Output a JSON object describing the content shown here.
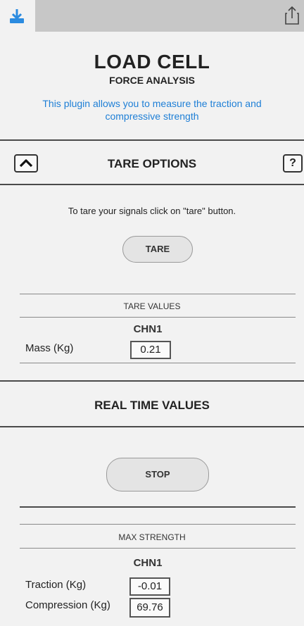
{
  "header": {
    "title": "LOAD CELL",
    "subtitle": "FORCE ANALYSIS",
    "description": "This plugin allows you to measure the traction and compressive strength"
  },
  "tare_section": {
    "title": "TARE OPTIONS",
    "help_label": "?",
    "instruction": "To tare your signals click on \"tare\" button.",
    "tare_button": "TARE",
    "values_heading": "TARE VALUES",
    "channel": "CHN1",
    "mass_label": "Mass (Kg)",
    "mass_value": "0.21"
  },
  "realtime_section": {
    "title": "REAL TIME VALUES",
    "stop_button": "STOP",
    "max_heading": "MAX STRENGTH",
    "channel": "CHN1",
    "traction_label": "Traction (Kg)",
    "traction_value": "-0.01",
    "compression_label": "Compression (Kg)",
    "compression_value": "69.76"
  },
  "icons": {
    "tab": "download-icon",
    "share": "share-icon",
    "collapse": "chevron-up-icon"
  },
  "colors": {
    "accent_text": "#1e7fd6",
    "icon_blue": "#2b8be0"
  }
}
